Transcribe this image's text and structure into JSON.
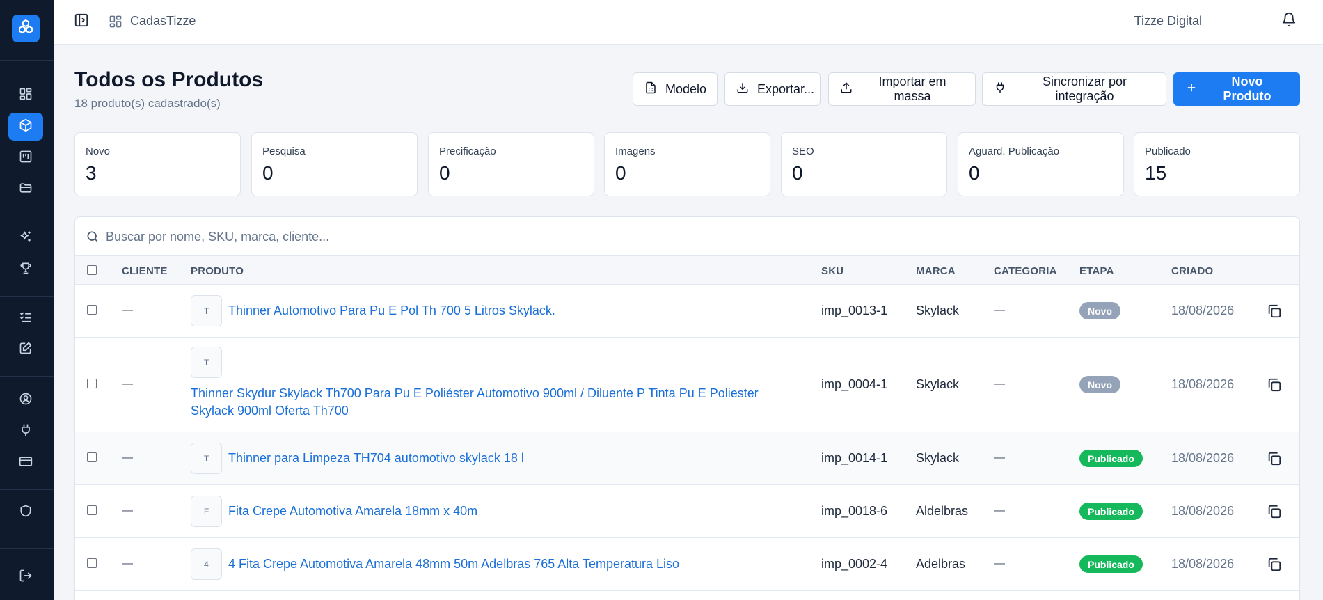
{
  "sidebar": {
    "logo_icon": "logo-icon",
    "items": [
      {
        "icon": "dashboard-icon"
      },
      {
        "icon": "cube-icon",
        "active": true
      },
      {
        "icon": "kanban-icon"
      },
      {
        "icon": "folder-icon"
      },
      {
        "icon": "sparkles-icon"
      },
      {
        "icon": "trophy-icon"
      },
      {
        "icon": "list-checks-icon"
      },
      {
        "icon": "edit-icon"
      },
      {
        "icon": "user-circle-icon"
      },
      {
        "icon": "plug-icon"
      },
      {
        "icon": "credit-card-icon"
      },
      {
        "icon": "shield-icon"
      },
      {
        "icon": "logout-icon"
      }
    ]
  },
  "topbar": {
    "app_name": "CadasTizze",
    "org_name": "Tizze Digital"
  },
  "header": {
    "title": "Todos os Produtos",
    "subtitle": "18 produto(s) cadastrado(s)"
  },
  "actions": {
    "modelo": "Modelo",
    "exportar": "Exportar...",
    "importar": "Importar em massa",
    "sincronizar": "Sincronizar por integração",
    "novo": "Novo Produto"
  },
  "stats": [
    {
      "label": "Novo",
      "value": "3"
    },
    {
      "label": "Pesquisa",
      "value": "0"
    },
    {
      "label": "Precificação",
      "value": "0"
    },
    {
      "label": "Imagens",
      "value": "0"
    },
    {
      "label": "SEO",
      "value": "0"
    },
    {
      "label": "Aguard. Publicação",
      "value": "0"
    },
    {
      "label": "Publicado",
      "value": "15"
    }
  ],
  "search": {
    "placeholder": "Buscar por nome, SKU, marca, cliente..."
  },
  "table": {
    "columns": {
      "cliente": "CLIENTE",
      "produto": "PRODUTO",
      "sku": "SKU",
      "marca": "MARCA",
      "categoria": "CATEGORIA",
      "etapa": "ETAPA",
      "criado": "CRIADO"
    },
    "rows": [
      {
        "cliente": "—",
        "thumb": "T",
        "produto": "Thinner Automotivo Para Pu E Pol Th 700 5 Litros Skylack.",
        "sku": "imp_0013-1",
        "marca": "Skylack",
        "categoria": "—",
        "etapa": "Novo",
        "criado": "18/08/2026"
      },
      {
        "cliente": "—",
        "thumb": "T",
        "produto": "Thinner Skydur Skylack Th700 Para Pu E Poliéster Automotivo 900ml / Diluente P Tinta Pu E Poliester Skylack 900ml Oferta Th700",
        "sku": "imp_0004-1",
        "marca": "Skylack",
        "categoria": "—",
        "etapa": "Novo",
        "criado": "18/08/2026"
      },
      {
        "cliente": "—",
        "thumb": "T",
        "produto": "Thinner para Limpeza TH704 automotivo skylack 18 l",
        "sku": "imp_0014-1",
        "marca": "Skylack",
        "categoria": "—",
        "etapa": "Publicado",
        "criado": "18/08/2026"
      },
      {
        "cliente": "—",
        "thumb": "F",
        "produto": "Fita Crepe Automotiva Amarela 18mm x 40m",
        "sku": "imp_0018-6",
        "marca": "Aldelbras",
        "categoria": "—",
        "etapa": "Publicado",
        "criado": "18/08/2026"
      },
      {
        "cliente": "—",
        "thumb": "4",
        "produto": "4 Fita Crepe Automotiva Amarela 48mm 50m Adelbras 765 Alta Temperatura Liso",
        "sku": "imp_0002-4",
        "marca": "Adelbras",
        "categoria": "—",
        "etapa": "Publicado",
        "criado": "18/08/2026"
      }
    ]
  },
  "colors": {
    "sidebar_bg": "#0f1b2d",
    "accent": "#1d7cf2",
    "badge_novo": "#94a3b8",
    "badge_publicado": "#16b85c",
    "link": "#1a6fd8"
  }
}
